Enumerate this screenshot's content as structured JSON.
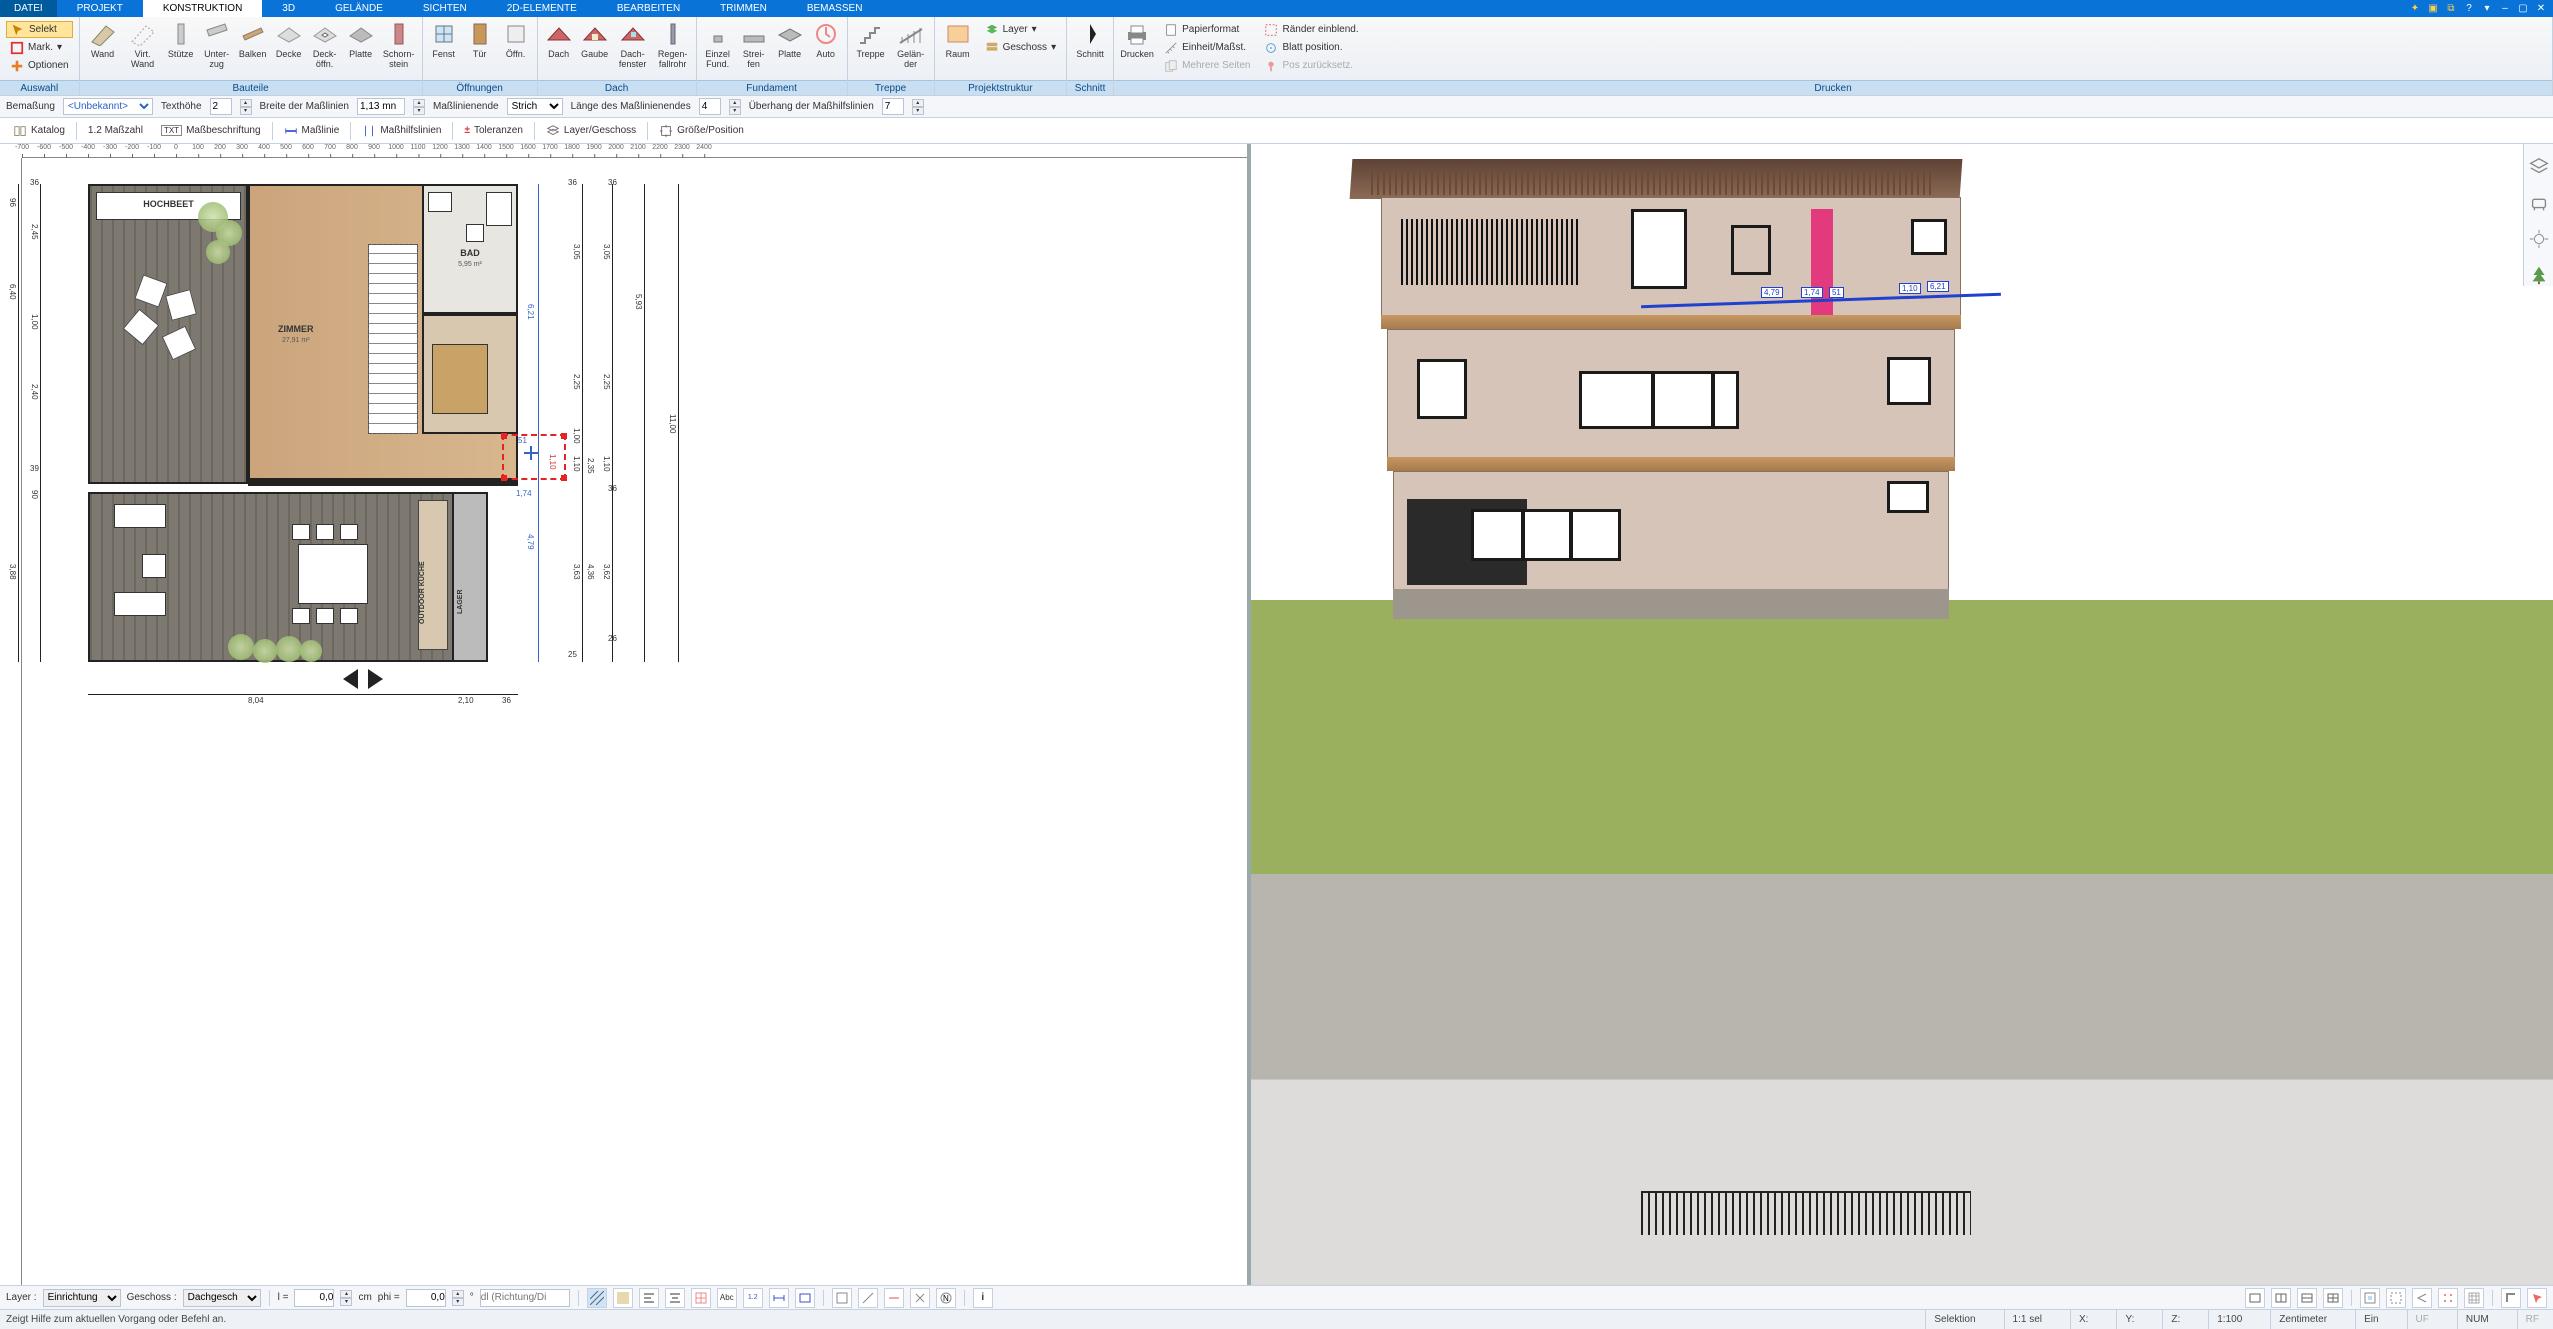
{
  "menu": {
    "tabs": [
      "DATEI",
      "PROJEKT",
      "KONSTRUKTION",
      "3D",
      "GELÄNDE",
      "SICHTEN",
      "2D-ELEMENTE",
      "BEARBEITEN",
      "TRIMMEN",
      "BEMASSEN"
    ],
    "active": 2
  },
  "ribbon": {
    "auswahl": {
      "label": "Auswahl",
      "selekt": "Selekt",
      "mark": "Mark.",
      "optionen": "Optionen"
    },
    "bauteile": {
      "label": "Bauteile",
      "wand": "Wand",
      "virtwand": "Virt.\nWand",
      "stuetze": "Stütze",
      "unterzug": "Unter-\nzug",
      "balken": "Balken",
      "decke": "Decke",
      "deckoeffn": "Deck-\nöffn.",
      "platte": "Platte",
      "schornstein": "Schorn-\nstein"
    },
    "oeffnungen": {
      "label": "Öffnungen",
      "fenst": "Fenst",
      "tuer": "Tür",
      "oeffn": "Öffn."
    },
    "dach": {
      "label": "Dach",
      "dach": "Dach",
      "gaube": "Gaube",
      "dachfenster": "Dach-\nfenster",
      "fallrohr": "Regen-\nfallrohr"
    },
    "fundament": {
      "label": "Fundament",
      "einzel": "Einzel\nFund.",
      "streifen": "Strei-\nfen",
      "platte": "Platte",
      "auto": "Auto"
    },
    "treppe": {
      "label": "Treppe",
      "treppe": "Treppe",
      "gelaender": "Gelän-\nder"
    },
    "projektstruktur": {
      "label": "Projektstruktur",
      "raum": "Raum",
      "layer": "Layer",
      "geschoss": "Geschoss"
    },
    "schnitt": {
      "label": "Schnitt",
      "schnitt": "Schnitt"
    },
    "drucken": {
      "label": "Drucken",
      "drucken": "Drucken",
      "papierformat": "Papierformat",
      "einheitmasst": "Einheit/Maßst.",
      "mehrereseiten": "Mehrere Seiten",
      "raendereinbl": "Ränder einblend.",
      "blattposition": "Blatt position.",
      "poszuruecksetz": "Pos zurücksetz."
    }
  },
  "optbar": {
    "bemassung": "Bemaßung",
    "style": "<Unbekannt>",
    "texthoehe": "Texthöhe",
    "texthoehe_v": "2",
    "breite": "Breite der Maßlinien",
    "breite_v": "1,13 mn",
    "masslinienende": "Maßlinienende",
    "ende_v": "Strich",
    "laenge": "Länge des Maßlinienendes",
    "laenge_v": "4",
    "ueberhang": "Überhang der Maßhilfslinien",
    "ueberhang_v": "7"
  },
  "tb2": {
    "katalog": "Katalog",
    "masszahl": "1.2 Maßzahl",
    "massbeschriftung": "Maßbeschriftung",
    "masslinie": "Maßlinie",
    "masshilfslinien": "Maßhilfslinien",
    "toleranzen": "Toleranzen",
    "layergeschoss": "Layer/Geschoss",
    "groesseposition": "Größe/Position"
  },
  "ruler": {
    "ticks": [
      "-700",
      "-600",
      "-500",
      "-400",
      "-300",
      "-200",
      "-100",
      "0",
      "100",
      "200",
      "300",
      "400",
      "500",
      "600",
      "700",
      "800",
      "900",
      "1000",
      "1100",
      "1200",
      "1300",
      "1400",
      "1500",
      "1600",
      "1700",
      "1800",
      "1900",
      "2000",
      "2100",
      "2200",
      "2300",
      "2400"
    ]
  },
  "plan": {
    "rooms": {
      "hochbeet": {
        "name": "HOCHBEET"
      },
      "zimmer": {
        "name": "ZIMMER",
        "area": "27,91 m²"
      },
      "bad": {
        "name": "BAD",
        "area": "5,95 m²"
      },
      "outdoor": {
        "name": "OUTDOOR KÜCHE"
      },
      "lager": {
        "name": "LAGER"
      }
    },
    "dims": {
      "d621": "6,21",
      "d593": "5,93",
      "d305": "3,05",
      "d225": "2,25",
      "d110": "1,10",
      "d100": "1,00",
      "d235": "2,35",
      "d363": "3,63",
      "d362": "3,62",
      "d436": "4,36",
      "d1100": "11,00",
      "d174": "1,74",
      "d479": "4,79",
      "d51": "51",
      "d36a": "36",
      "d36b": "36",
      "d36c": "36",
      "d36d": "36",
      "d25": "25",
      "d26": "26",
      "d804": "8,04",
      "d210": "2,10",
      "d640": "6,40",
      "d245": "2,45",
      "d100v": "1,00",
      "d240": "2,40",
      "d388": "3,88",
      "d39": "39",
      "d90": "90",
      "d96": "96"
    }
  },
  "view3d": {
    "tags": {
      "t479": "4,79",
      "t174": "1,74",
      "t51": "51",
      "t110": "1,10",
      "t621": "6,21"
    }
  },
  "bb1": {
    "layer_lbl": "Layer :",
    "layer_v": "Einrichtung",
    "geschoss_lbl": "Geschoss :",
    "geschoss_v": "Dachgesch",
    "l_lbl": "l =",
    "l_v": "0,0",
    "cm": "cm",
    "phi_lbl": "phi =",
    "phi_v": "0,0",
    "deg": "°",
    "dl_ph": "dl (Richtung/Di"
  },
  "status": {
    "hint": "Zeigt Hilfe zum aktuellen Vorgang oder Befehl an.",
    "selektion": "Selektion",
    "sel": "1:1 sel",
    "x": "X:",
    "y": "Y:",
    "z": "Z:",
    "scale": "1:100",
    "unit": "Zentimeter",
    "ein": "Ein",
    "uf": "UF",
    "num": "NUM",
    "rf": "RF"
  }
}
